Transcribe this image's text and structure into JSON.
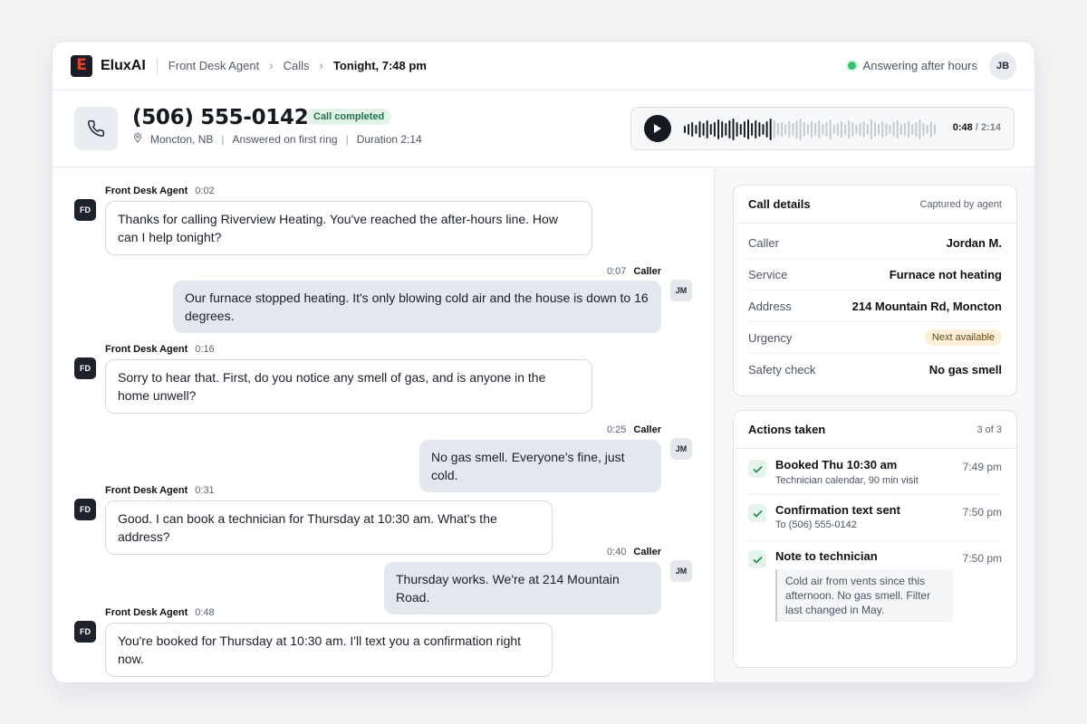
{
  "app": {
    "logo_letter": "E",
    "brand": "EluxAI"
  },
  "breadcrumb": [
    "Front Desk Agent",
    "Calls"
  ],
  "breadcrumb_current": "Tonight, 7:48 pm",
  "status": {
    "text": "Answering after hours",
    "color": "#35c46b"
  },
  "user": {
    "initials": "JB"
  },
  "call": {
    "number": "(506) 555-0142",
    "status_badge": "Call completed",
    "location": "Moncton, NB",
    "answered": "Answered on first ring",
    "duration": "Duration 2:14"
  },
  "player": {
    "current": "0:48",
    "separator": " / ",
    "total": "2:14",
    "progress": 0.36
  },
  "messages": [
    {
      "role": "agent",
      "speaker": "Front Desk Agent",
      "time": "0:02",
      "initials": "FD",
      "text": "Thanks for calling Riverview Heating. You've reached the after-hours line. How can I help tonight?"
    },
    {
      "role": "caller",
      "speaker": "Caller",
      "time": "0:07",
      "initials": "JM",
      "text": "Our furnace stopped heating. It's only blowing cold air and the house is down to 16 degrees."
    },
    {
      "role": "agent",
      "speaker": "Front Desk Agent",
      "time": "0:16",
      "initials": "FD",
      "text": "Sorry to hear that. First, do you notice any smell of gas, and is anyone in the home unwell?"
    },
    {
      "role": "caller",
      "speaker": "Caller",
      "time": "0:25",
      "initials": "JM",
      "text": "No gas smell. Everyone's fine, just cold."
    },
    {
      "role": "agent",
      "speaker": "Front Desk Agent",
      "time": "0:31",
      "initials": "FD",
      "text": "Good. I can book a technician for Thursday at 10:30 am. What's the address?"
    },
    {
      "role": "caller",
      "speaker": "Caller",
      "time": "0:40",
      "initials": "JM",
      "text": "Thursday works. We're at 214 Mountain Road."
    },
    {
      "role": "agent",
      "speaker": "Front Desk Agent",
      "time": "0:48",
      "initials": "FD",
      "text": "You're booked for Thursday at 10:30 am. I'll text you a confirmation right now."
    }
  ],
  "call_details": {
    "title": "Call details",
    "subtitle": "Captured by agent",
    "caller_label": "Caller",
    "caller": "Jordan M.",
    "service_label": "Service",
    "service": "Furnace not heating",
    "address_label": "Address",
    "address": "214 Mountain Rd, Moncton",
    "urgency_label": "Urgency",
    "urgency": "Next available",
    "safety_label": "Safety check",
    "safety": "No gas smell"
  },
  "actions": {
    "title": "Actions taken",
    "count": "3 of 3",
    "items": [
      {
        "title": "Booked Thu 10:30 am",
        "detail": "Technician calendar, 90 min visit",
        "time": "7:49 pm"
      },
      {
        "title": "Confirmation text sent",
        "detail": "To (506) 555-0142",
        "time": "7:50 pm"
      },
      {
        "title": "Note to technician",
        "detail": "Cold air from vents since this afternoon. No gas smell. Filter last changed in May.",
        "time": "7:50 pm"
      }
    ]
  }
}
